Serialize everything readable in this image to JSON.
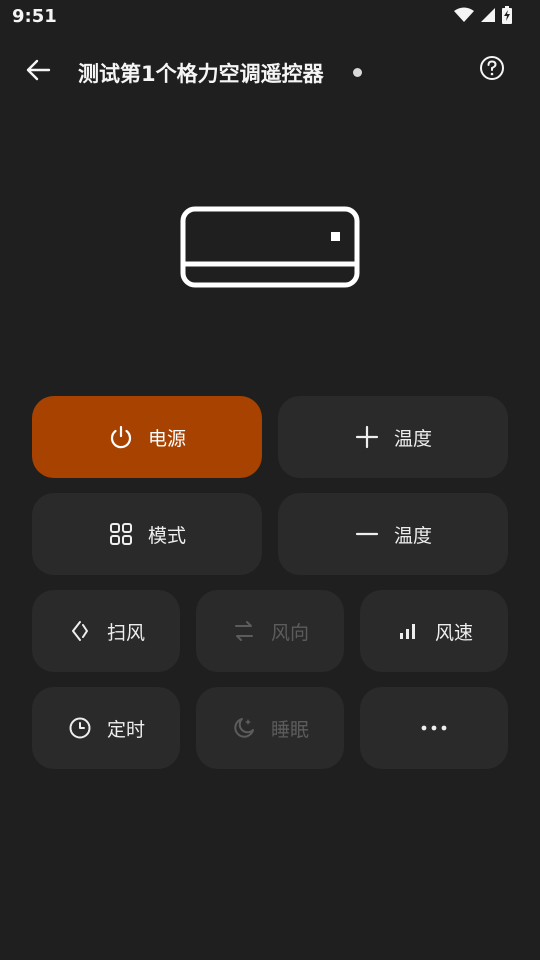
{
  "status": {
    "time": "9:51",
    "icons": [
      "wifi-icon",
      "signal-icon",
      "battery-charging-icon"
    ]
  },
  "app_bar": {
    "title": "测试第1个格力空调遥控器",
    "back_icon": "arrow-left-icon",
    "help_icon": "help-circle-icon"
  },
  "colors": {
    "background": "#1f1f1f",
    "button": "#2a2a2a",
    "accent": "#a84200",
    "disabled": "#5c5c5c"
  },
  "buttons": {
    "power": {
      "label": "电源",
      "icon": "power-icon",
      "active": true
    },
    "temp_up": {
      "label": "温度",
      "icon": "plus-icon"
    },
    "mode": {
      "label": "模式",
      "icon": "grid-icon"
    },
    "temp_down": {
      "label": "温度",
      "icon": "minus-icon"
    },
    "swing": {
      "label": "扫风",
      "icon": "swing-icon"
    },
    "direction": {
      "label": "风向",
      "icon": "wind-direction-icon",
      "disabled": true
    },
    "speed": {
      "label": "风速",
      "icon": "bar-chart-icon"
    },
    "timer": {
      "label": "定时",
      "icon": "clock-icon"
    },
    "sleep": {
      "label": "睡眠",
      "icon": "moon-icon",
      "disabled": true
    },
    "more": {
      "label": "",
      "icon": "more-horizontal-icon"
    }
  }
}
